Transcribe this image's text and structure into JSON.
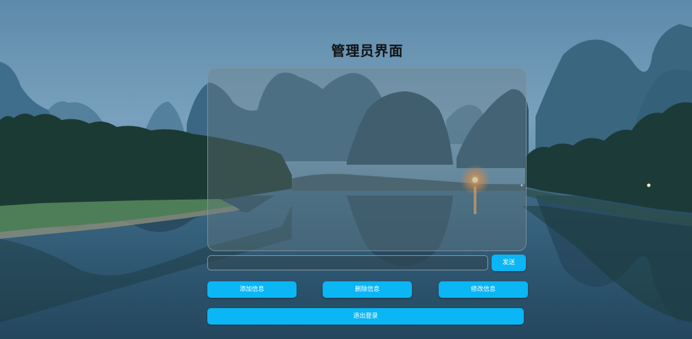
{
  "page": {
    "title": "管理员界面"
  },
  "chat": {
    "input_value": "",
    "input_placeholder": "",
    "send_label": "发送"
  },
  "actions": {
    "add_label": "添加信息",
    "delete_label": "删除信息",
    "modify_label": "修改信息",
    "logout_label": "退出登录"
  },
  "colors": {
    "button": "#0ab6f4",
    "title": "#111111",
    "sky": "#6f9ab8",
    "water": "#2c5470"
  }
}
